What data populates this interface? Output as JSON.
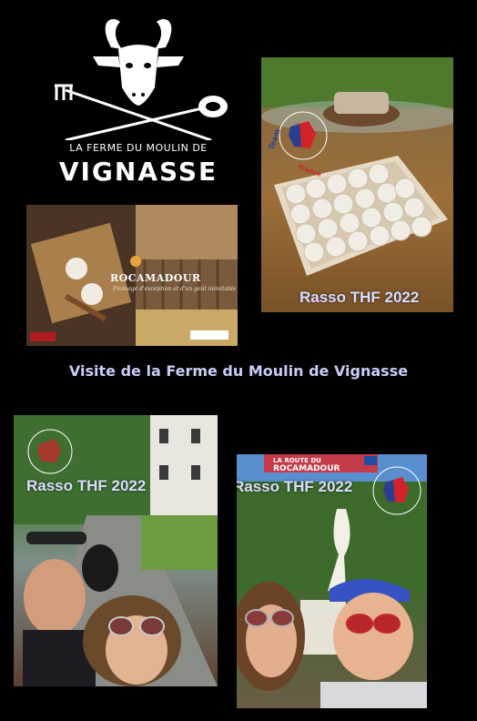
{
  "logo": {
    "top_text": "LA FERME DU MOULIN DE",
    "bottom_text": "VIGNASSE"
  },
  "caption": "Visite de la Ferme du Moulin de Vignasse",
  "rasso_label": "Rasso THF 2022",
  "team_badge": {
    "top": "Team",
    "middle": "Hayabusa",
    "bottom": "France"
  },
  "rocamadour": {
    "title": "ROCAMADOUR",
    "subtitle": "Fromage d'exception et d'un goût inimitable"
  },
  "road_sign": {
    "line1": "LA ROUTE DU",
    "line2": "ROCAMADOUR"
  },
  "colors": {
    "background": "#000000",
    "caption_text": "#c7cdf5",
    "badge_red": "#d2232a",
    "badge_blue": "#2a3f8f"
  }
}
